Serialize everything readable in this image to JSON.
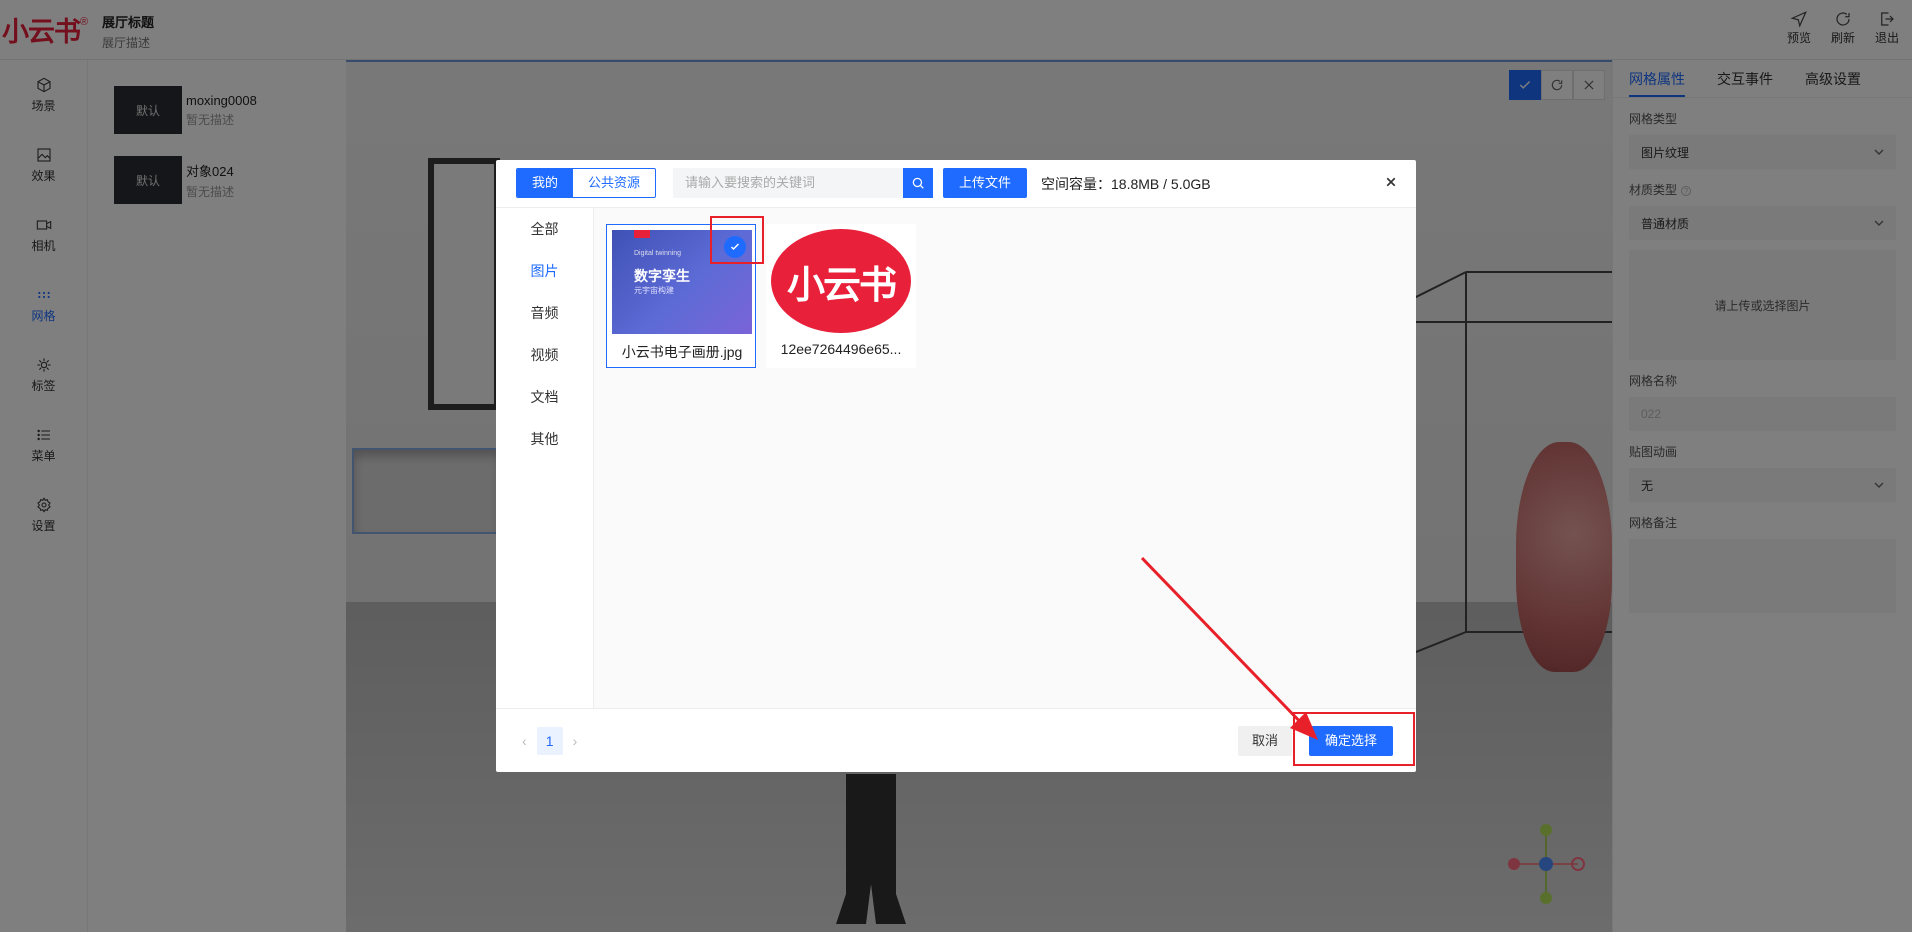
{
  "header": {
    "logo": "小云书",
    "logo_mark": "®",
    "hall_title": "展厅标题",
    "hall_desc": "展厅描述",
    "actions": [
      {
        "label": "预览",
        "icon": "send-icon"
      },
      {
        "label": "刷新",
        "icon": "refresh-icon"
      },
      {
        "label": "退出",
        "icon": "logout-icon"
      }
    ]
  },
  "nav": {
    "items": [
      {
        "label": "场景",
        "icon": "cube-icon"
      },
      {
        "label": "效果",
        "icon": "image-icon"
      },
      {
        "label": "相机",
        "icon": "camera-icon"
      },
      {
        "label": "网格",
        "icon": "grid-icon",
        "active": true
      },
      {
        "label": "标签",
        "icon": "tag-icon"
      },
      {
        "label": "菜单",
        "icon": "list-icon"
      },
      {
        "label": "设置",
        "icon": "gear-icon"
      }
    ]
  },
  "objects": [
    {
      "thumb": "默认",
      "name": "moxing0008",
      "desc": "暂无描述"
    },
    {
      "thumb": "默认",
      "name": "对象024",
      "desc": "暂无描述"
    }
  ],
  "right_panel": {
    "tabs": [
      "网格属性",
      "交互事件",
      "高级设置"
    ],
    "active_tab": "网格属性",
    "mesh_type_label": "网格类型",
    "mesh_type_value": "图片纹理",
    "material_type_label": "材质类型",
    "material_type_value": "普通材质",
    "upload_hint": "请上传或选择图片",
    "mesh_name_label": "网格名称",
    "mesh_name_placeholder": "022",
    "texture_anim_label": "贴图动画",
    "texture_anim_value": "无",
    "mesh_note_label": "网格备注"
  },
  "modal": {
    "scope_tabs": [
      "我的",
      "公共资源"
    ],
    "active_scope": "我的",
    "search_placeholder": "请输入要搜索的关键词",
    "upload_label": "上传文件",
    "capacity": "空间容量：18.8MB / 5.0GB",
    "categories": [
      "全部",
      "图片",
      "音频",
      "视频",
      "文档",
      "其他"
    ],
    "active_category": "图片",
    "files": [
      {
        "name": "小云书电子画册.jpg",
        "selected": true,
        "cover_en": "Digital twinning",
        "cover_title": "数字孪生",
        "cover_sub": "元宇宙构建"
      },
      {
        "name": "12ee7264496e65...",
        "selected": false,
        "logo_text": "小云书"
      }
    ],
    "page": "1",
    "cancel_label": "取消",
    "confirm_label": "确定选择"
  },
  "colors": {
    "accent": "#1f6bff",
    "brand": "#e8203a",
    "annotation": "#e8202a"
  }
}
